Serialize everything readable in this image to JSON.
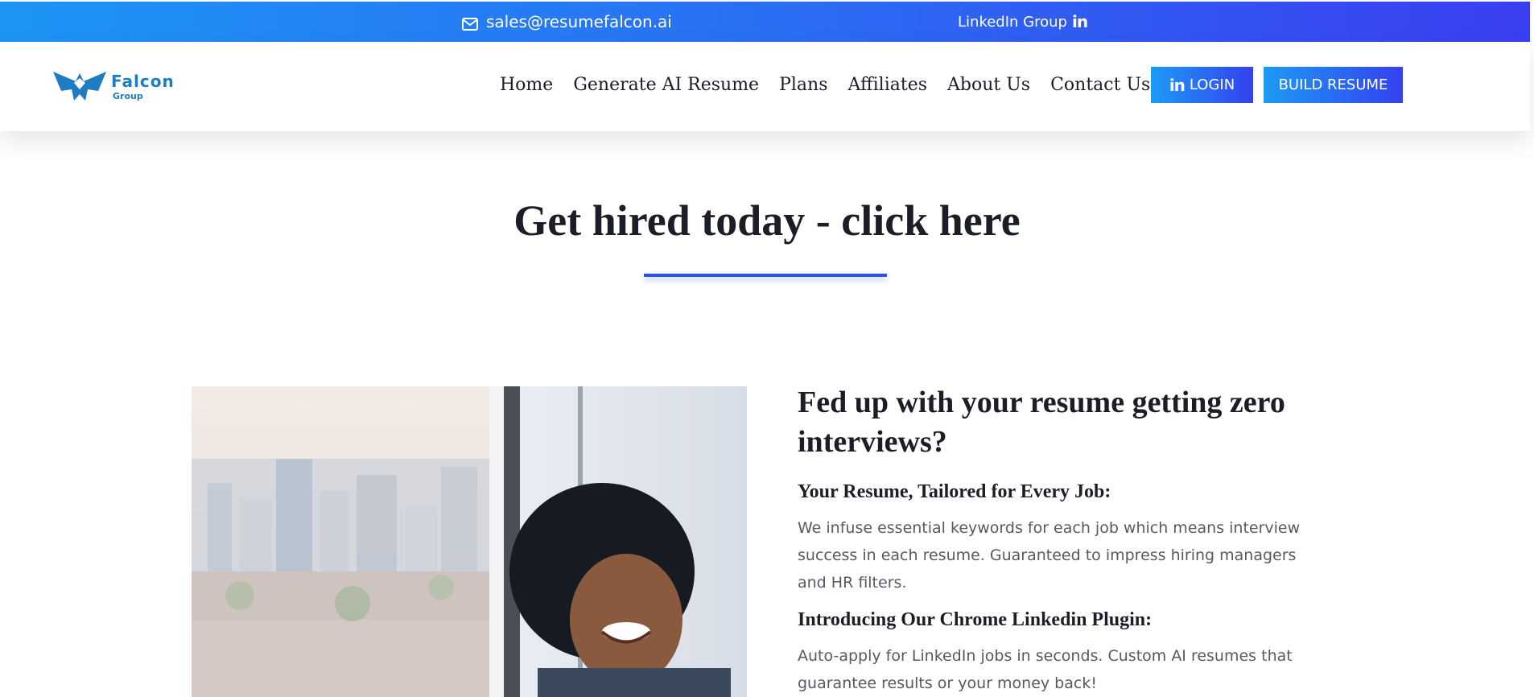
{
  "topbar": {
    "email": "sales@resumefalcon.ai",
    "linkedin_label": "LinkedIn Group",
    "linkedin_icon": "in",
    "gradient": [
      "#1d95f6",
      "#3a3ff2"
    ]
  },
  "header": {
    "logo": {
      "brand": "Falcon",
      "sub": "Group",
      "color": "#1f7cc2"
    },
    "nav": [
      "Home",
      "Generate AI Resume",
      "Plans",
      "Affiliates",
      "About Us",
      "Contact Us"
    ],
    "login_icon": "in",
    "login_label": "LOGIN",
    "build_label": "BUILD RESUME"
  },
  "hero": {
    "title": "Get hired today - click here",
    "rule_color": "#2b52e0"
  },
  "content": {
    "heading": "Fed up with your resume getting zero interviews?",
    "section1_title": "Your Resume, Tailored for Every Job:",
    "section1_text": "We infuse essential keywords for each job which means interview success in each resume. Guaranteed to impress hiring managers and HR filters.",
    "section2_title": "Introducing Our Chrome Linkedin Plugin:",
    "section2_text": "Auto-apply for LinkedIn jobs in seconds. Custom AI resumes that guarantee results or your money back!"
  }
}
